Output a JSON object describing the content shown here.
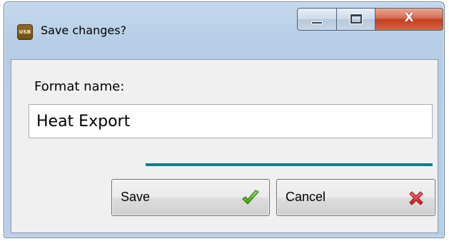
{
  "window": {
    "title": "Save changes?",
    "app_icon_text": "USB",
    "caption_buttons": {
      "minimize_icon": "minimize-icon",
      "maximize_icon": "maximize-icon",
      "close_glyph": "X"
    }
  },
  "form": {
    "label": "Format name:",
    "input_value": "Heat Export"
  },
  "buttons": {
    "save_label": "Save",
    "save_icon": "checkmark-icon",
    "cancel_label": "Cancel",
    "cancel_icon": "red-x-icon"
  },
  "colors": {
    "accent_line": "#117f86",
    "check_green": "#4caa1c",
    "cancel_red": "#e0242e"
  }
}
